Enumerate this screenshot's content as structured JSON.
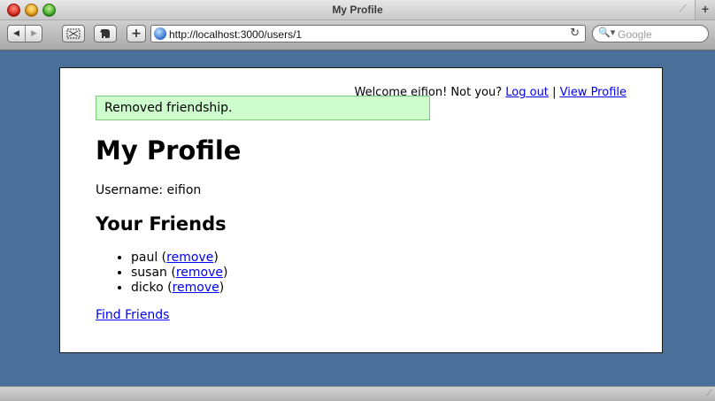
{
  "window": {
    "title": "My Profile",
    "new_tab_glyph": "+"
  },
  "toolbar": {
    "back_glyph": "◀",
    "forward_glyph": "▶",
    "add_glyph": "+",
    "url": "http://localhost:3000/users/1",
    "reload_glyph": "↻",
    "search_placeholder": "Google",
    "search_glyph": "🔍▾"
  },
  "page": {
    "userbar": {
      "welcome": "Welcome eifion! Not you?",
      "logout_label": "Log out",
      "separator": "|",
      "view_profile_label": "View Profile"
    },
    "flash": "Removed friendship.",
    "title": "My Profile",
    "username_line": "Username: eifion",
    "friends_heading": "Your Friends",
    "friends": [
      {
        "name": "paul",
        "remove_label": "remove"
      },
      {
        "name": "susan",
        "remove_label": "remove"
      },
      {
        "name": "dicko",
        "remove_label": "remove"
      }
    ],
    "find_friends_label": "Find Friends"
  },
  "colors": {
    "desktop": "#4a7099",
    "flash_bg": "#cdfccd",
    "flash_border": "#7fc97f",
    "link": "#0000ee"
  }
}
